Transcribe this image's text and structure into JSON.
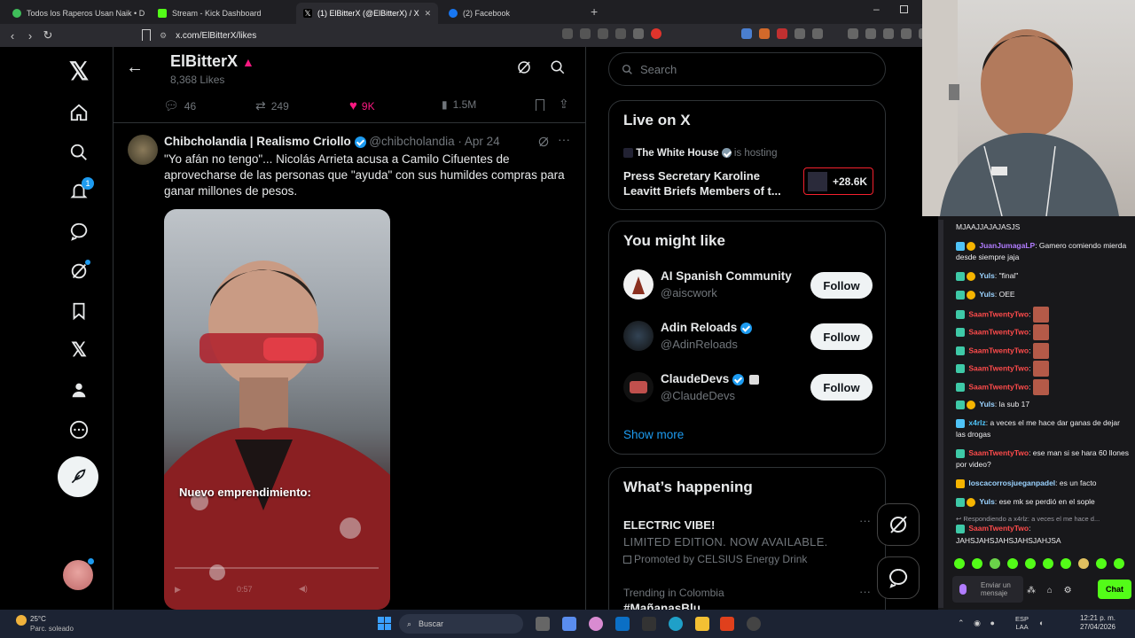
{
  "browser": {
    "tabs": [
      {
        "label": "Todos los Raperos Usan Naik • D..."
      },
      {
        "label": "Stream - Kick Dashboard"
      },
      {
        "label": "(1) ElBitterX (@ElBitterX) / X"
      },
      {
        "label": "(2) Facebook"
      }
    ],
    "url": "x.com/ElBitterX/likes"
  },
  "profile": {
    "name": "ElBitterX",
    "likes": "8,368 Likes"
  },
  "prev_tweet_actions": {
    "replies": "46",
    "reposts": "249",
    "likes": "9K",
    "views": "1.5M"
  },
  "tweet": {
    "author": "Chibcholandia | Realismo Criollo",
    "handle": "@chibcholandia",
    "date": "· Apr 24",
    "text": "\"Yo afán no tengo\"... Nicolás Arrieta acusa a Camilo Cifuentes de aprovecharse de las personas que \"ayuda\" con sus humildes compras para ganar millones de pesos.",
    "video_caption": "Nuevo emprendimiento:",
    "video_time": "0:57"
  },
  "search": {
    "placeholder": "Search"
  },
  "live": {
    "heading": "Live on X",
    "host": "The White House",
    "hosting": "is hosting",
    "title": "Press Secretary Karoline Leavitt Briefs Members of t...",
    "count": "+28.6K"
  },
  "might_like": {
    "heading": "You might like",
    "users": [
      {
        "name": "AI Spanish Community",
        "handle": "@aiscwork",
        "button": "Follow"
      },
      {
        "name": "Adin Reloads",
        "handle": "@AdinReloads",
        "button": "Follow"
      },
      {
        "name": "ClaudeDevs",
        "handle": "@ClaudeDevs",
        "button": "Follow"
      }
    ],
    "show_more": "Show more"
  },
  "happening": {
    "heading": "What’s happening",
    "promo_title": "ELECTRIC VIBE!",
    "promo_sub": "LIMITED EDITION. NOW AVAILABLE.",
    "promo_by": "Promoted by CELSIUS Energy Drink",
    "trend_label": "Trending in Colombia",
    "trend_name": "#MañanasBlu"
  },
  "chat": {
    "lines": [
      {
        "user": "",
        "text": "MJAAJJAJAJASJS"
      },
      {
        "user": "JuanJumagaLP",
        "text": ": Gamero comiendo mierda desde siempre jaja"
      },
      {
        "user": "Yuls",
        "text": ": \"final\""
      },
      {
        "user": "Yuls",
        "text": ": OEE"
      },
      {
        "user": "SaamTwentyTwo",
        "text": ":"
      },
      {
        "user": "SaamTwentyTwo",
        "text": ":"
      },
      {
        "user": "SaamTwentyTwo",
        "text": ":"
      },
      {
        "user": "SaamTwentyTwo",
        "text": ":"
      },
      {
        "user": "SaamTwentyTwo",
        "text": ":"
      },
      {
        "user": "Yuls",
        "text": ": la sub 17"
      },
      {
        "user": "x4rlz",
        "text": ": a veces el me hace dar ganas de dejar las drogas"
      },
      {
        "user": "SaamTwentyTwo",
        "text": ": ese man si se hara 60 llones por video?"
      },
      {
        "user": "loscacorrosjueganpadel",
        "text": ": es un facto"
      },
      {
        "user": "Yuls",
        "text": ": ese mk se perdió en el sople"
      },
      {
        "user": "",
        "text": "Respondiendo a x4rlz: a veces el me hace d..."
      },
      {
        "user": "SaamTwentyTwo",
        "text": ":"
      },
      {
        "user": "",
        "text": "JAHSJAHSJAHSJAHSJAHJSA"
      }
    ],
    "send_label": "Enviar un mensaje",
    "chat_button": "Chat"
  },
  "taskbar": {
    "weather_temp": "25°C",
    "weather_desc": "Parc. soleado",
    "search": "Buscar",
    "lang1": "ESP",
    "lang2": "LAA",
    "time": "12:21 p. m.",
    "date": "27/04/2026"
  },
  "colors": {
    "accent": "#1d9bf0",
    "like": "#f91880",
    "live_border": "#f4212e",
    "chat_user_red": "#ff4b4b",
    "chat_user_cyan": "#4fc3f7",
    "kick_green": "#53fc18"
  }
}
